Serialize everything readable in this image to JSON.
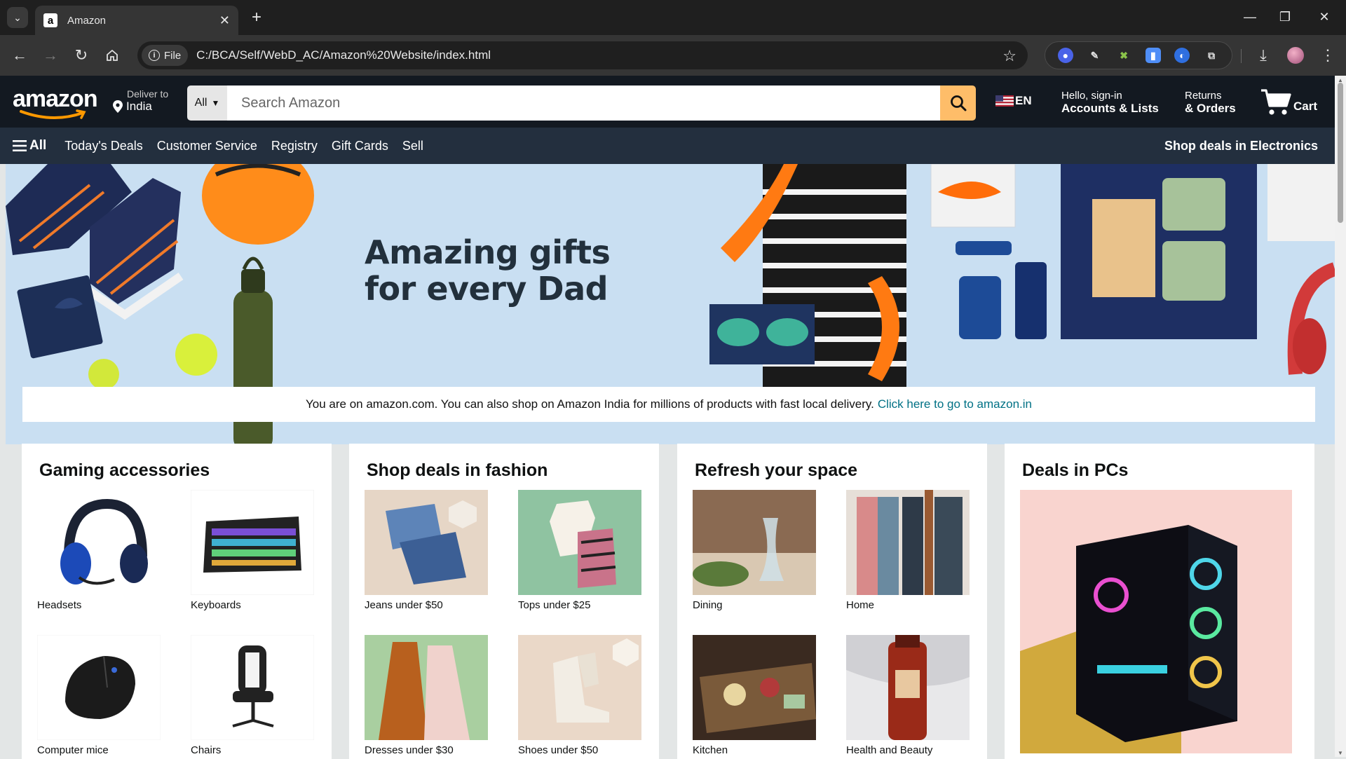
{
  "browser": {
    "tab_title": "Amazon",
    "favicon_letter": "a",
    "file_chip": "File",
    "url": "C:/BCA/Self/WebD_AC/Amazon%20Website/index.html"
  },
  "header": {
    "logo_text": "amazon",
    "deliver_line1": "Deliver to",
    "deliver_line2": "India",
    "search_category": "All",
    "search_placeholder": "Search Amazon",
    "lang": "EN",
    "account_line1": "Hello, sign-in",
    "account_line2": "Accounts & Lists",
    "orders_line1": "Returns",
    "orders_line2": "& Orders",
    "cart_label": "Cart"
  },
  "nav": {
    "all": "All",
    "links": [
      "Today's Deals",
      "Customer Service",
      "Registry",
      "Gift Cards",
      "Sell"
    ],
    "right": "Shop deals in Electronics"
  },
  "hero": {
    "title_line1": "Amazing gifts",
    "title_line2": "for every Dad"
  },
  "notice": {
    "text": "You are on amazon.com. You can also shop on Amazon India for millions of products with fast local delivery.",
    "link": "Click here to go to amazon.in"
  },
  "cards": [
    {
      "title": "Gaming accessories",
      "items": [
        "Headsets",
        "Keyboards",
        "Computer mice",
        "Chairs"
      ]
    },
    {
      "title": "Shop deals in fashion",
      "items": [
        "Jeans under $50",
        "Tops under $25",
        "Dresses under $30",
        "Shoes under $50"
      ]
    },
    {
      "title": "Refresh your space",
      "items": [
        "Dining",
        "Home",
        "Kitchen",
        "Health and Beauty"
      ]
    },
    {
      "title": "Deals in PCs"
    }
  ],
  "colors": {
    "amazon_dark": "#131921",
    "amazon_nav": "#232f3e",
    "search_button": "#febd69",
    "link": "#007185",
    "hero_bg": "#c9dff2"
  }
}
